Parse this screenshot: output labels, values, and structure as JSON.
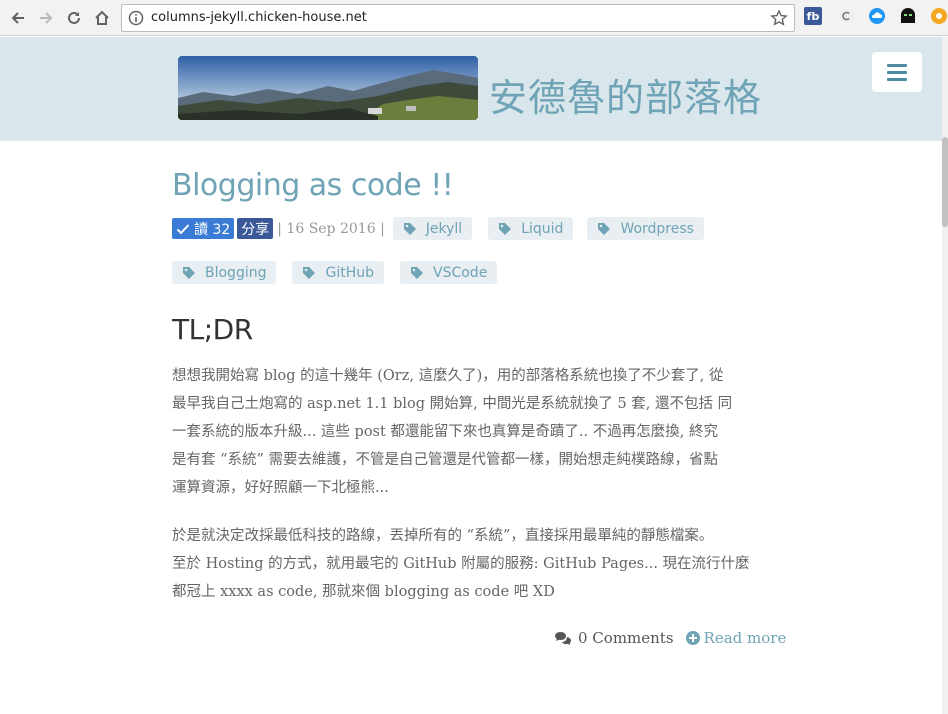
{
  "browser": {
    "url": "columns-jekyll.chicken-house.net",
    "extensions": [
      {
        "name": "fb",
        "label": "fb",
        "color": "#3b5998"
      },
      {
        "name": "c",
        "label": "C",
        "color": "#888888"
      },
      {
        "name": "cloud",
        "label": "",
        "color": "#2196f3"
      },
      {
        "name": "ghost",
        "label": "",
        "color": "#111111"
      },
      {
        "name": "orange",
        "label": "",
        "color": "#f5a623"
      }
    ]
  },
  "site": {
    "title": "安德魯的部落格"
  },
  "post": {
    "title": "Blogging as code !!",
    "read_label": "讀 32",
    "share_label": "分享",
    "date_text": "| 16 Sep 2016 |",
    "tags": [
      "Jekyll",
      "Liquid",
      "Wordpress",
      "Blogging",
      "GitHub",
      "VSCode"
    ],
    "heading": "TL;DR",
    "paragraphs": [
      [
        "想想我開始寫 blog 的這十幾年 (Orz, 這麼久了)，用的部落格系統也換了不少套了, 從",
        "最早我自己土炮寫的 asp.net 1.1 blog 開始算, 中間光是系統就換了 5 套, 還不包括 同",
        "一套系統的版本升級... 這些 post 都還能留下來也真算是奇蹟了.. 不過再怎麼換, 終究",
        "是有套 “系統” 需要去維護，不管是自己管還是代管都一樣，開始想走純樸路線，省點",
        "運算資源，好好照顧一下北極熊..."
      ],
      [
        "於是就決定改採最低科技的路線，丟掉所有的 “系統”，直接採用最單純的靜態檔案。",
        "至於 Hosting 的方式，就用最宅的 GitHub 附屬的服務: GitHub Pages... 現在流行什麼",
        "都冠上 xxxx as code, 那就來個 blogging as code 吧 XD"
      ]
    ],
    "comments_label": "0 Comments",
    "readmore_label": "Read more"
  },
  "colors": {
    "accent": "#6fa3b6",
    "header_bg": "#d9e6ec",
    "read_badge": "#3a7bd5",
    "share_badge": "#3b5998"
  }
}
